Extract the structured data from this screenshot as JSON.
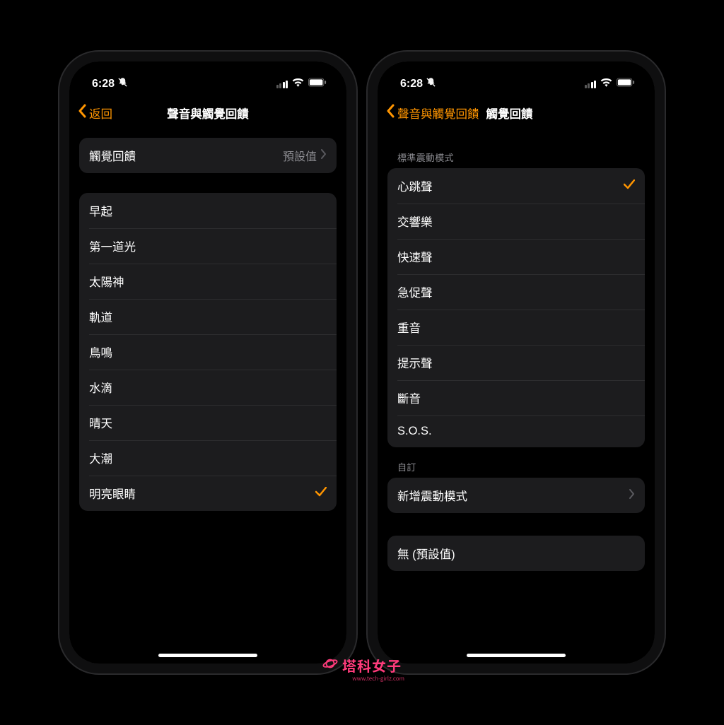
{
  "status": {
    "time": "6:28"
  },
  "left": {
    "back_label": "返回",
    "title": "聲音與觸覺回饋",
    "haptic_row": {
      "label": "觸覺回饋",
      "value": "預設值"
    },
    "sounds": [
      "早起",
      "第一道光",
      "太陽神",
      "軌道",
      "鳥鳴",
      "水滴",
      "晴天",
      "大潮",
      "明亮眼睛"
    ],
    "selected_index": 8
  },
  "right": {
    "back_label": "聲音與觸覺回饋",
    "title": "觸覺回饋",
    "section1_header": "標準震動模式",
    "patterns": [
      "心跳聲",
      "交響樂",
      "快速聲",
      "急促聲",
      "重音",
      "提示聲",
      "斷音",
      "S.O.S."
    ],
    "selected_index": 0,
    "section2_header": "自訂",
    "add_label": "新增震動模式",
    "none_label": "無 (預設值)"
  },
  "watermark": {
    "text": "塔科女子",
    "sub": "www.tech-girlz.com"
  }
}
